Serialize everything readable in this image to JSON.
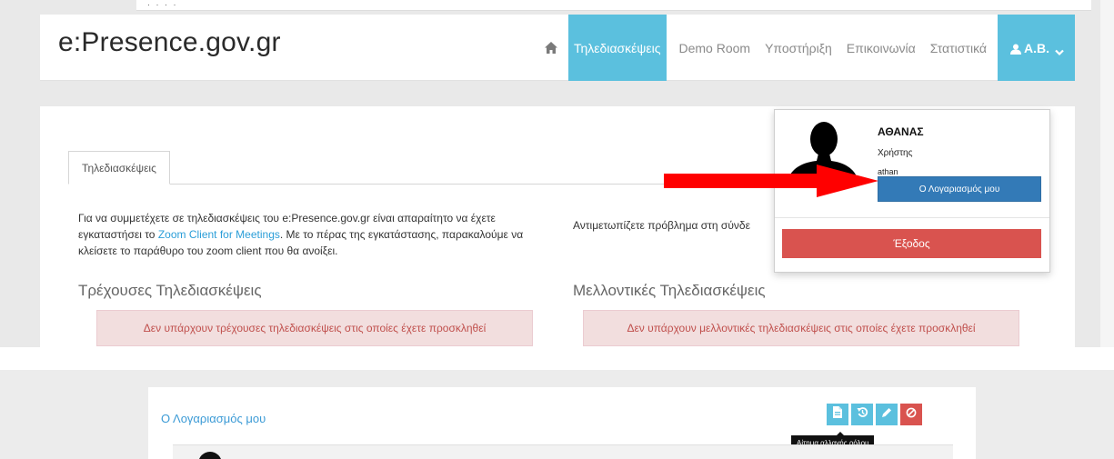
{
  "top": {
    "scroll_marks": "· ·   ·  ·",
    "brand": "e:Presence.gov.gr",
    "nav": {
      "home_icon": "home-icon",
      "items": [
        {
          "label": "Τηλεδιασκέψεις",
          "active": true
        },
        {
          "label": "Demo Room",
          "active": false
        },
        {
          "label": "Υποστήριξη",
          "active": false
        },
        {
          "label": "Επικοινωνία",
          "active": false
        },
        {
          "label": "Στατιστικά",
          "active": false
        }
      ],
      "user_label": "A.B."
    },
    "tab_label": "Τηλεδιασκέψεις",
    "intro": {
      "part1": "Για να συμμετέχετε σε τηλεδιασκέψεις του e:Presence.gov.gr είναι απαραίτητο να έχετε εγκαταστήσει το ",
      "link": "Zoom Client for Meetings",
      "part2": ". Με το πέρας της εγκατάστασης, παρακαλούμε να κλείσετε το παράθυρο του zoom client που θα ανοίξει."
    },
    "problem_text": "Αντιμετωπίζετε πρόβλημα στη σύνδε",
    "current": {
      "title": "Τρέχουσες Τηλεδιασκέψεις",
      "alert": "Δεν υπάρχουν τρέχουσες τηλεδιασκέψεις στις οποίες έχετε προσκληθεί"
    },
    "future": {
      "title": "Μελλοντικές Τηλεδιασκέψεις",
      "alert": "Δεν υπάρχουν μελλοντικές τηλεδιασκέψεις στις οποίες έχετε προσκληθεί"
    },
    "dropdown": {
      "name": "ΑΘΑΝΑΣ",
      "role": "Χρήστης",
      "email": "athan",
      "account_button": "Ο Λογαριασμός μου",
      "logout_button": "Έξοδος"
    }
  },
  "bottom": {
    "panel_title": "Ο Λογαριασμός μου",
    "buttons": [
      "file-icon",
      "undo-icon",
      "pencil-icon",
      "ban-icon"
    ],
    "tooltip": "Αίτημα αλλαγής ρόλου"
  },
  "colors": {
    "accent": "#5bc0de",
    "primary": "#337ab7",
    "danger": "#d9534f",
    "alert_bg": "#f2dede",
    "alert_text": "#c0504d",
    "arrow": "#ff0000"
  }
}
